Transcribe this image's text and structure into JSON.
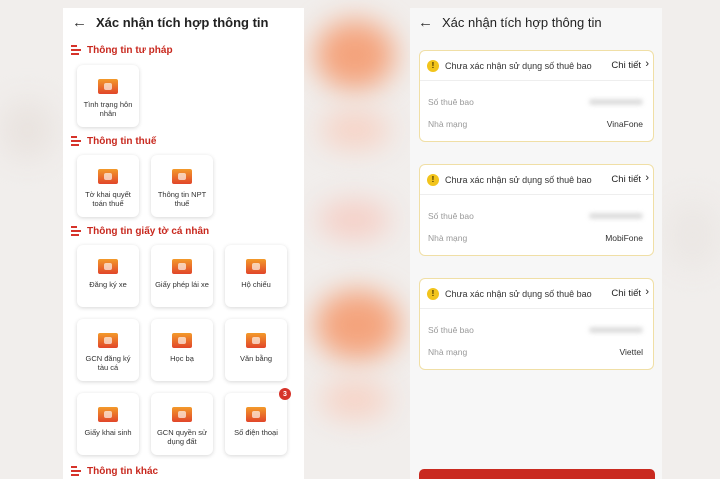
{
  "left": {
    "header": {
      "title": "Xác nhận tích hợp thông tin",
      "back_icon": "arrow-left-icon"
    },
    "sections": [
      {
        "title": "Thông tin tư pháp",
        "items": [
          {
            "label": "Tình trạng hôn nhân"
          }
        ]
      },
      {
        "title": "Thông tin thuế",
        "items": [
          {
            "label": "Tờ khai quyết toán thuế"
          },
          {
            "label": "Thông tin NPT thuế"
          }
        ]
      },
      {
        "title": "Thông tin giấy tờ cá nhân",
        "items": [
          {
            "label": "Đăng ký xe"
          },
          {
            "label": "Giấy phép lái xe"
          },
          {
            "label": "Hộ chiếu"
          },
          {
            "label": "GCN đăng ký tàu cá"
          },
          {
            "label": "Học bạ"
          },
          {
            "label": "Văn bằng"
          },
          {
            "label": "Giấy khai sinh"
          },
          {
            "label": "GCN quyền sử dụng đất"
          },
          {
            "label": "Số điện thoại",
            "badge": "3"
          }
        ]
      },
      {
        "title": "Thông tin khác",
        "items": []
      }
    ]
  },
  "right": {
    "header": {
      "title": "Xác nhận tích hợp thông tin",
      "back_icon": "arrow-left-icon"
    },
    "cards": [
      {
        "status": "Chưa xác nhận sử dụng số thuê bao",
        "detail": "Chi tiết",
        "subscriber_label": "Số thuê bao",
        "carrier_label": "Nhà mạng",
        "carrier": "VinaFone"
      },
      {
        "status": "Chưa xác nhận sử dụng số thuê bao",
        "detail": "Chi tiết",
        "subscriber_label": "Số thuê bao",
        "carrier_label": "Nhà mạng",
        "carrier": "MobiFone"
      },
      {
        "status": "Chưa xác nhận sử dụng số thuê bao",
        "detail": "Chi tiết",
        "subscriber_label": "Số thuê bao",
        "carrier_label": "Nhà mạng",
        "carrier": "Viettel"
      }
    ]
  },
  "colors": {
    "accent": "#c8281e",
    "warning": "#f2c41c",
    "card_border": "#f0dfa6"
  }
}
